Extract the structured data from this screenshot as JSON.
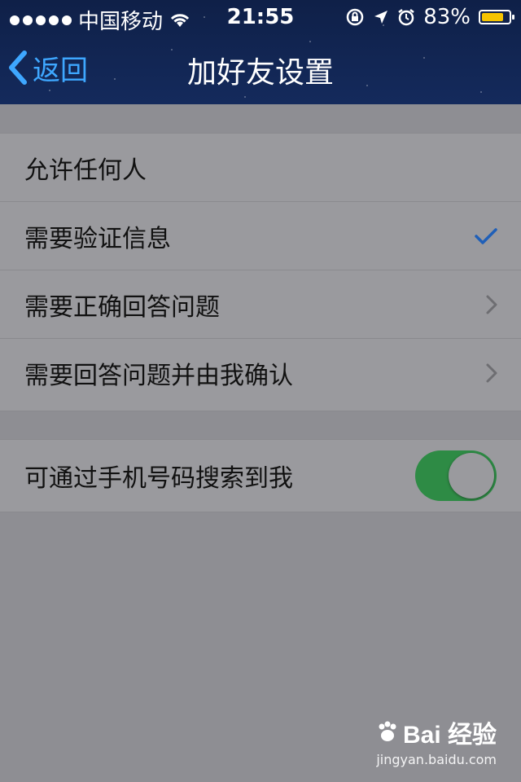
{
  "status_bar": {
    "carrier": "中国移动",
    "time": "21:55",
    "battery_percent": "83%",
    "battery_level": 0.83,
    "battery_color": "#f5c400",
    "icons": [
      "signal-dots-icon",
      "wifi-icon",
      "rotation-lock-icon",
      "location-arrow-icon",
      "alarm-icon",
      "battery-icon"
    ]
  },
  "nav": {
    "back_label": "返回",
    "title": "加好友设置",
    "accent_color": "#3ea7ff"
  },
  "options": [
    {
      "label": "允许任何人",
      "accessory": "none"
    },
    {
      "label": "需要验证信息",
      "accessory": "checkmark-icon",
      "selected": true
    },
    {
      "label": "需要正确回答问题",
      "accessory": "chevron-right-icon"
    },
    {
      "label": "需要回答问题并由我确认",
      "accessory": "chevron-right-icon"
    }
  ],
  "phone_search": {
    "label": "可通过手机号码搜索到我",
    "enabled": true,
    "on_color": "#2e8b45"
  },
  "watermark": {
    "brand": "Bai 经验",
    "url": "jingyan.baidu.com"
  }
}
